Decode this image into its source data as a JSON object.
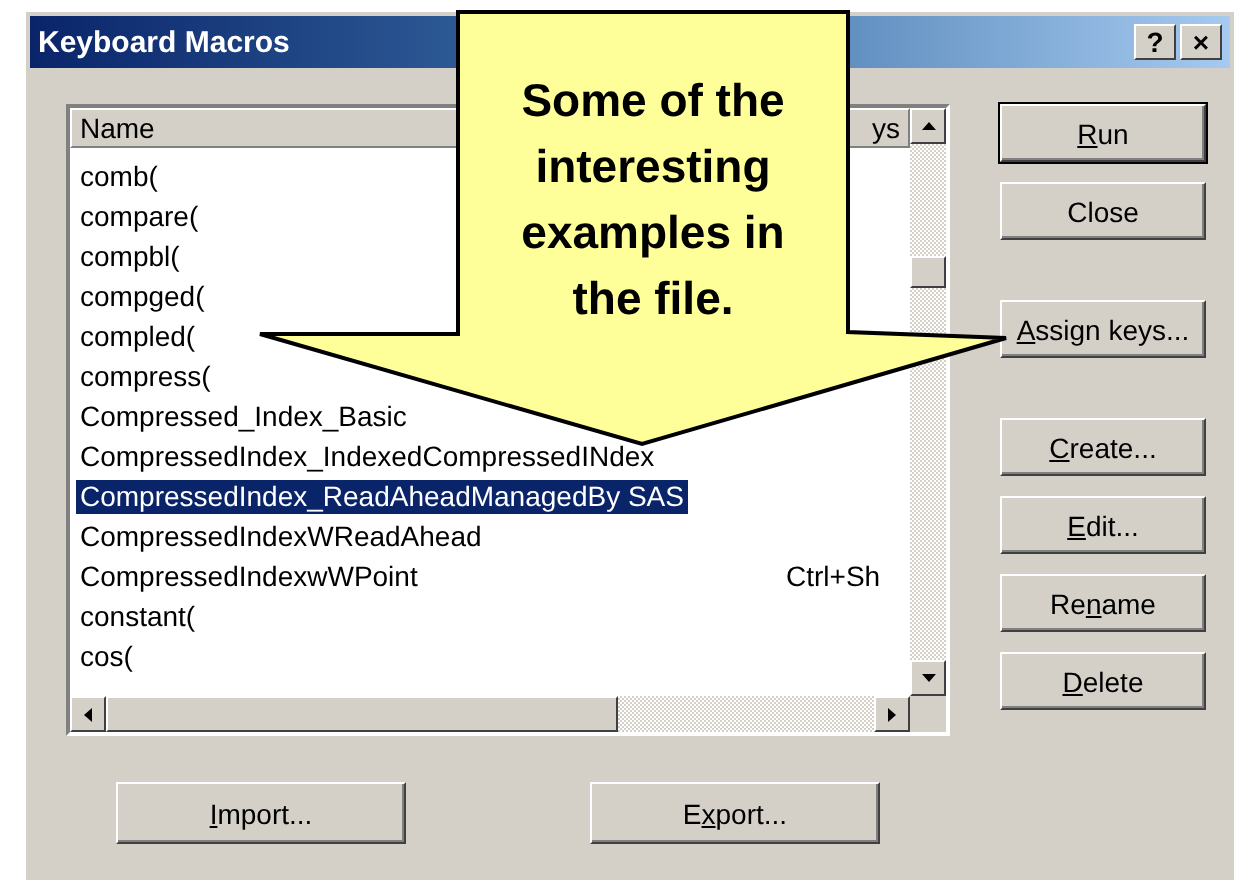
{
  "window": {
    "title": "Keyboard Macros",
    "help_button": "?",
    "close_button": "×"
  },
  "macro_list": {
    "columns": [
      {
        "kind": "name",
        "label": "Name"
      },
      {
        "kind": "keys",
        "label": "ys"
      }
    ],
    "rows": [
      {
        "name": "comb(",
        "selected": false
      },
      {
        "name": "compare(",
        "selected": false
      },
      {
        "name": "compbl(",
        "selected": false
      },
      {
        "name": "compged(",
        "selected": false
      },
      {
        "name": "compled(",
        "selected": false
      },
      {
        "name": "compress(",
        "selected": false
      },
      {
        "name": "Compressed_Index_Basic",
        "selected": false
      },
      {
        "name": "CompressedIndex_IndexedCompressedINdex",
        "selected": false
      },
      {
        "name": "CompressedIndex_ReadAheadManagedBy SAS",
        "selected": true
      },
      {
        "name": "CompressedIndexWReadAhead",
        "selected": false
      },
      {
        "name": "CompressedIndexwWPoint",
        "keys": "Ctrl+Sh",
        "selected": false
      },
      {
        "name": "constant(",
        "selected": false
      },
      {
        "name": "cos(",
        "selected": false
      }
    ]
  },
  "side_button_groups": [
    [
      {
        "key": "R",
        "post": "un",
        "default": true
      },
      {
        "post": "Close",
        "default": false
      }
    ],
    [
      {
        "key": "A",
        "post": "ssign keys...",
        "default": false
      }
    ],
    [
      {
        "key": "C",
        "post": "reate...",
        "default": false
      },
      {
        "key": "E",
        "post": "dit...",
        "default": false
      },
      {
        "pre": "Re",
        "key": "n",
        "post": "ame",
        "default": false
      },
      {
        "key": "D",
        "post": "elete",
        "default": false
      }
    ]
  ],
  "bottom_buttons": [
    {
      "key": "I",
      "post": "mport..."
    },
    {
      "pre": "E",
      "key": "x",
      "post": "port..."
    }
  ],
  "callout": {
    "text": [
      "Some of the",
      "interesting",
      "examples in",
      "the file."
    ]
  }
}
